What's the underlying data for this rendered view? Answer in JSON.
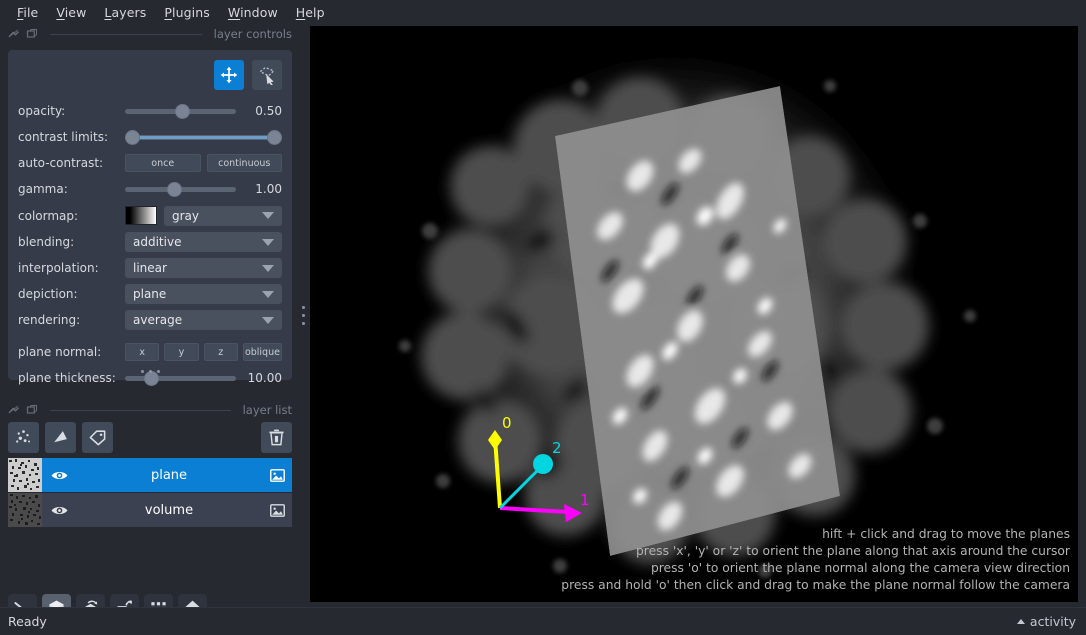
{
  "menubar": {
    "items": [
      {
        "label": "File",
        "accel": "F"
      },
      {
        "label": "View",
        "accel": "V"
      },
      {
        "label": "Layers",
        "accel": "L"
      },
      {
        "label": "Plugins",
        "accel": "P"
      },
      {
        "label": "Window",
        "accel": "W"
      },
      {
        "label": "Help",
        "accel": "H"
      }
    ]
  },
  "layer_controls": {
    "dock_title": "layer controls",
    "modes": [
      {
        "name": "pan-zoom",
        "active": true
      },
      {
        "name": "transform",
        "active": false
      }
    ],
    "opacity": {
      "label": "opacity:",
      "value": "0.50",
      "fraction": 0.5
    },
    "contrast_limits": {
      "label": "contrast limits:",
      "low": 0.0,
      "high": 1.0
    },
    "auto_contrast": {
      "label": "auto-contrast:",
      "once": "once",
      "continuous": "continuous"
    },
    "gamma": {
      "label": "gamma:",
      "value": "1.00",
      "fraction": 0.39
    },
    "colormap": {
      "label": "colormap:",
      "value": "gray"
    },
    "blending": {
      "label": "blending:",
      "value": "additive"
    },
    "interpolation": {
      "label": "interpolation:",
      "value": "linear"
    },
    "depiction": {
      "label": "depiction:",
      "value": "plane"
    },
    "rendering": {
      "label": "rendering:",
      "value": "average"
    },
    "plane_normal": {
      "label": "plane normal:",
      "buttons": [
        "x",
        "y",
        "z",
        "oblique"
      ]
    },
    "plane_thickness": {
      "label": "plane thickness:",
      "value": "10.00",
      "fraction": 0.12
    }
  },
  "layer_list": {
    "dock_title": "layer list",
    "buttons": [
      "points-layer-button",
      "shapes-layer-button",
      "labels-layer-button",
      "delete-layer-button"
    ],
    "layers": [
      {
        "name": "plane",
        "selected": true,
        "visible": true,
        "type": "image"
      },
      {
        "name": "volume",
        "selected": false,
        "visible": true,
        "type": "image"
      }
    ]
  },
  "viewer_buttons": [
    {
      "name": "console",
      "active": false
    },
    {
      "name": "ndisplay-toggle",
      "active": true
    },
    {
      "name": "roll-dims",
      "active": false
    },
    {
      "name": "transpose-dims",
      "active": false
    },
    {
      "name": "grid-view",
      "active": false
    },
    {
      "name": "home",
      "active": false
    }
  ],
  "canvas": {
    "axes": [
      {
        "label": "0",
        "color": "#ffff00"
      },
      {
        "label": "1",
        "color": "#ff00ff"
      },
      {
        "label": "2",
        "color": "#00d5e0"
      }
    ],
    "hints": [
      "hift + click and drag to move the planes",
      "press 'x', 'y' or 'z' to orient the plane along that axis around the cursor",
      "press 'o' to orient the plane normal along the camera view direction",
      "press and hold 'o' then click and drag to make the plane normal follow the camera"
    ]
  },
  "statusbar": {
    "status": "Ready",
    "activity": "activity"
  },
  "colors": {
    "accent": "#0a7fd4",
    "panel": "#353b48",
    "background": "#262930",
    "canvas": "#000000"
  }
}
